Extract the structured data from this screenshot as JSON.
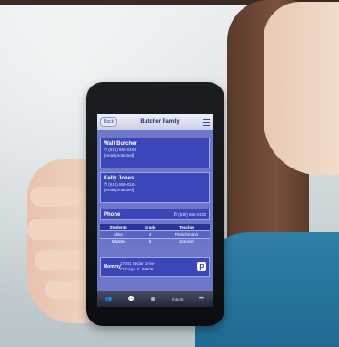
{
  "nav": {
    "back_label": "Back",
    "title": "Butcher Family"
  },
  "contacts": [
    {
      "name": "Walt Butcher",
      "phone": "(610) 555-0193",
      "email": "[email protected]"
    },
    {
      "name": "Kelly Jones",
      "phone": "(610) 555-0161",
      "email": "[email protected]"
    }
  ],
  "phone_row": {
    "label": "Phone",
    "value": "(610) 555-0102"
  },
  "classes": {
    "headers": [
      "Students",
      "Grade",
      "Teacher"
    ],
    "rows": [
      [
        "Mike",
        "4",
        "Fleischmann"
      ],
      [
        "Maddie",
        "6",
        "Johnson"
      ]
    ]
  },
  "home": {
    "label": "Mommy",
    "address_line1": "17041 Sedar Drive",
    "address_line2": "Chicago, IL 60606"
  },
  "tabbar": {
    "tab4_label": "Import"
  },
  "icons": {
    "phone": "phone-icon",
    "menu": "menu-icon",
    "parking": "parking-icon"
  },
  "colors": {
    "screen_bg": "#6f78c8",
    "card_bg": "#3b47b8",
    "nav_title": "#1d2a7a"
  }
}
